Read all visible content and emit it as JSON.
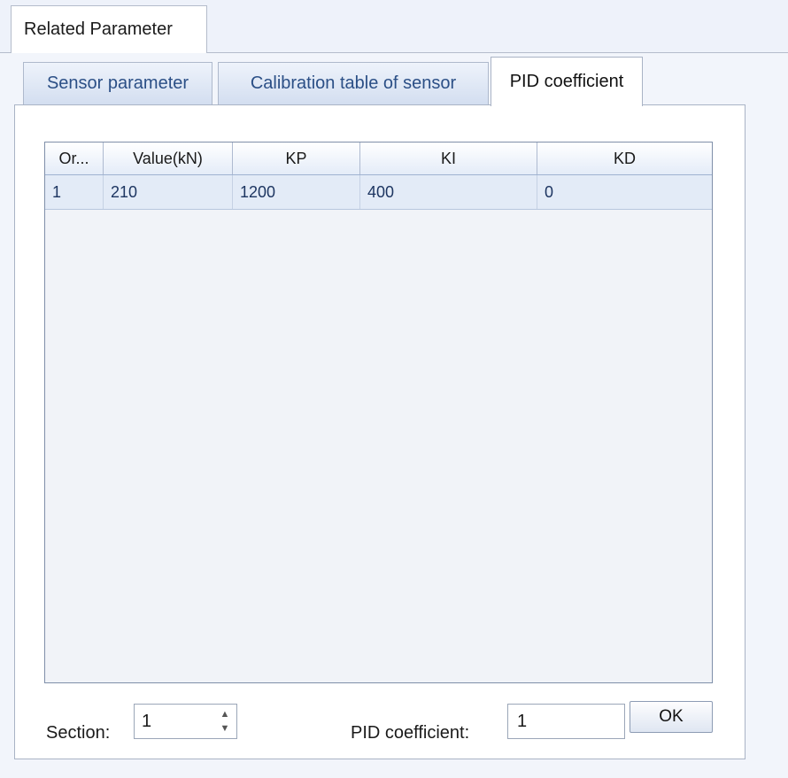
{
  "outer_tab": {
    "label": "Related Parameter"
  },
  "tabs": [
    {
      "label": "Sensor parameter",
      "active": false
    },
    {
      "label": "Calibration table of sensor",
      "active": false
    },
    {
      "label": "PID coefficient",
      "active": true
    }
  ],
  "table": {
    "columns": [
      "Or...",
      "Value(kN)",
      "KP",
      "KI",
      "KD"
    ],
    "rows": [
      [
        "1",
        "210",
        "1200",
        "400",
        "0"
      ]
    ]
  },
  "footer": {
    "section_label": "Section:",
    "section_value": "1",
    "pid_label": "PID coefficient:",
    "pid_value": "1",
    "ok_label": "OK"
  },
  "colors": {
    "tab_text": "#2b4f86",
    "row_bg": "#e3ebf7",
    "background": "#eef2fa"
  }
}
